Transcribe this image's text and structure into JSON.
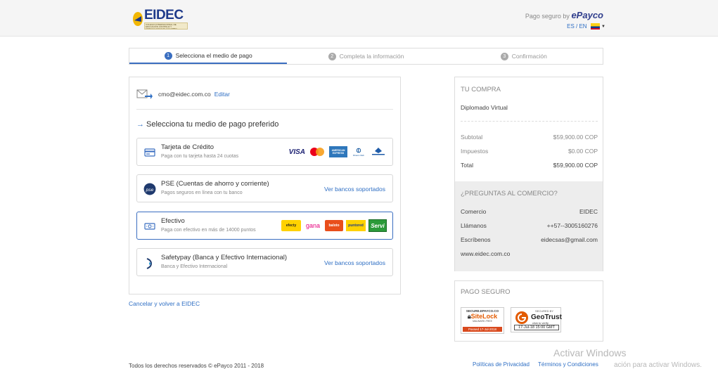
{
  "header": {
    "logo_text": "EIDEC",
    "logo_sub": "COLEGIO INTERNACIONAL DE EDUCACIÓN CONTINUA Y ESPECIALIZADA DE COLOMBIA",
    "pago_seguro": "Pago seguro by",
    "brand": "ePayco",
    "lang_es": "ES",
    "lang_sep": " / ",
    "lang_en": "EN"
  },
  "steps": [
    {
      "num": "1",
      "label": "Selecciona el medio de pago"
    },
    {
      "num": "2",
      "label": "Completa la información"
    },
    {
      "num": "3",
      "label": "Confirmación"
    }
  ],
  "main": {
    "email": "cmo@eidec.com.co",
    "edit_label": "Editar",
    "select_title": "Selecciona tu medio de pago preferido",
    "methods": [
      {
        "title": "Tarjeta de Crédito",
        "subtitle": "Paga con tu tarjeta hasta 24 cuotas"
      },
      {
        "title": "PSE (Cuentas de ahorro y corriente)",
        "subtitle": "Pagos seguros en línea con tu banco",
        "link": "Ver bancos soportados"
      },
      {
        "title": "Efectivo",
        "subtitle": "Paga con efectivo en más de 14000 puntos"
      },
      {
        "title": "Safetypay (Banca y Efectivo Internacional)",
        "subtitle": "Banca y Efectivo Internacional",
        "link": "Ver bancos soportados"
      }
    ],
    "card_logos": [
      "VISA",
      "AMERICAN EXPRESS",
      "Diners Club"
    ],
    "cash_logos": [
      "efecty",
      "gana",
      "baloto",
      "puntored",
      "Servi"
    ],
    "cancel_label": "Cancelar y volver a EIDEC"
  },
  "summary": {
    "heading": "TU COMPRA",
    "product": "Diplomado Virtual",
    "rows": [
      {
        "label": "Subtotal",
        "value": "$59,900.00 COP"
      },
      {
        "label": "Impuestos",
        "value": "$0.00 COP"
      },
      {
        "label": "Total",
        "value": "$59,900.00 COP"
      }
    ],
    "faq_heading": "¿PREGUNTAS AL COMERCIO?",
    "faq_rows": [
      {
        "label": "Comercio",
        "value": "EIDEC"
      },
      {
        "label": "Llámanos",
        "value": "++57--3005160276"
      },
      {
        "label": "Escríbenos",
        "value": "eidecsas@gmail.com"
      },
      {
        "label": "www.eidec.com.co",
        "value": ""
      }
    ]
  },
  "secure": {
    "heading": "PAGO SEGURO",
    "sitelock_top": "SECURE.EPAYCO.CO",
    "sitelock_name": "SiteLock",
    "sitelock_sub": "MALWARE-FREE",
    "sitelock_passed": "Passed  17-Jul-2018",
    "gt_secured": "SECURED BY",
    "gt_name": "GeoTrust",
    "gt_click": "click to verify",
    "gt_date": "17-Jul-18 15:00 GMT"
  },
  "footer": {
    "copyright": "Todos los derechos reservados © ePayco 2011 - 2018",
    "privacy": "Políticas de Privacidad",
    "terms": "Términos y Condiciones"
  },
  "windows": {
    "line1": "Activar Windows",
    "line2": "ación para activar Windows."
  },
  "colors": {
    "accent": "#3a6ec0",
    "link": "#2f6fc4",
    "brand": "#2f3d8c"
  }
}
